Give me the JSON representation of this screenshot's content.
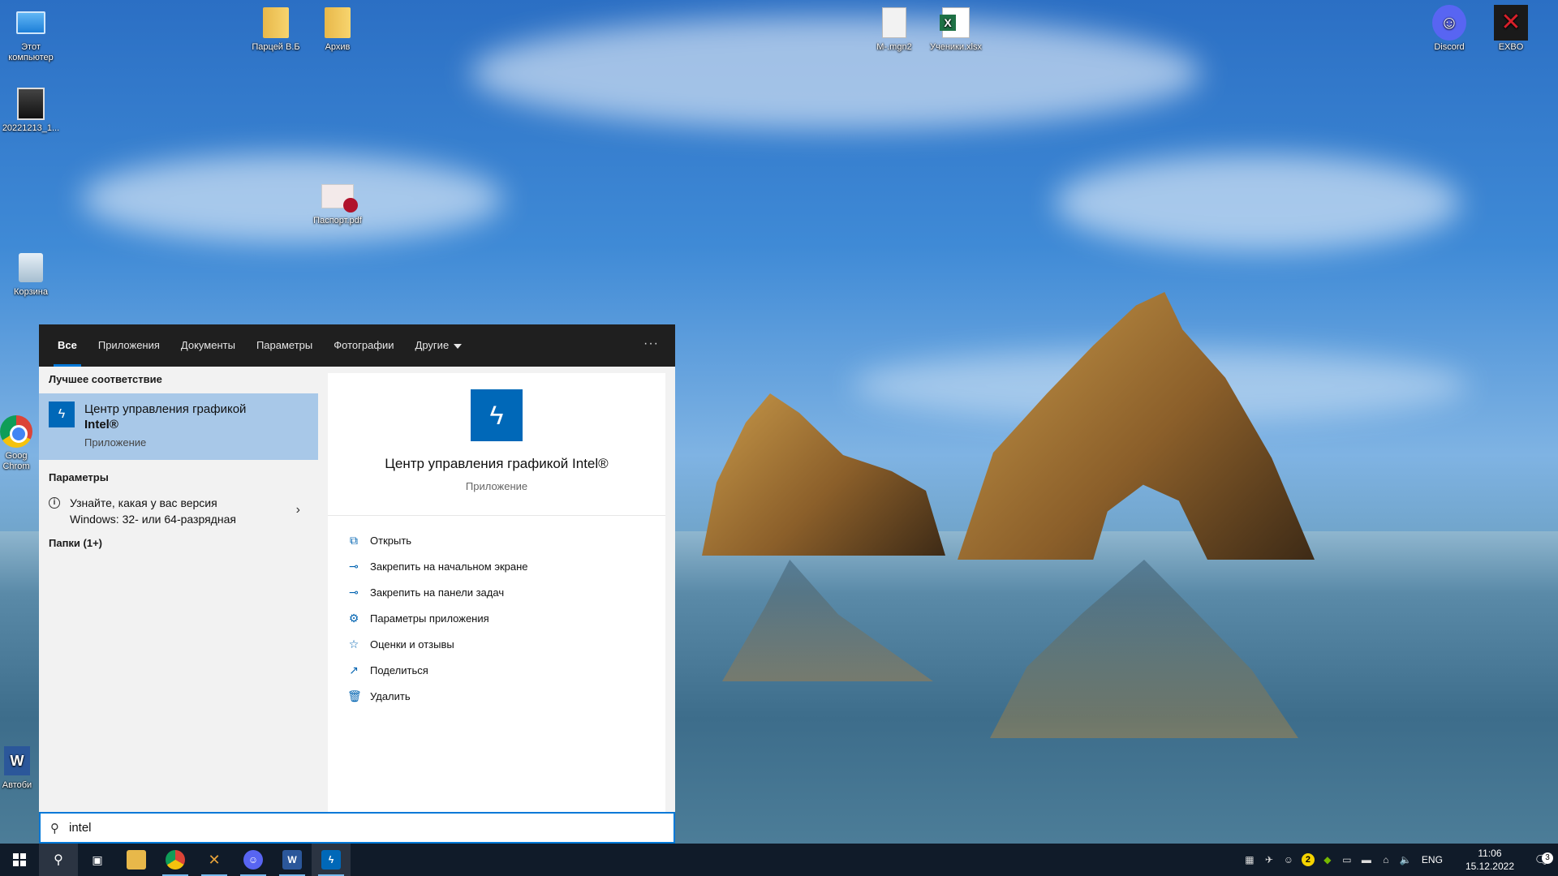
{
  "desktop": {
    "icons": [
      {
        "label": "Этот компьютер"
      },
      {
        "label": "20221213_1..."
      },
      {
        "label": "Корзина"
      },
      {
        "label": "Goog Chrom"
      },
      {
        "label": "Автоби"
      },
      {
        "label": "Парцей В.Б"
      },
      {
        "label": "Архив"
      },
      {
        "label": "Паспорт.pdf"
      },
      {
        "label": "M-.mgn2"
      },
      {
        "label": "Ученики.xlsx"
      },
      {
        "label": "Discord"
      },
      {
        "label": "EXBO"
      }
    ]
  },
  "search": {
    "tabs": [
      {
        "label": "Все"
      },
      {
        "label": "Приложения"
      },
      {
        "label": "Документы"
      },
      {
        "label": "Параметры"
      },
      {
        "label": "Фотографии"
      },
      {
        "label": "Другие"
      }
    ],
    "more_label": "···",
    "best_match_header": "Лучшее соответствие",
    "best_match": {
      "title_line1": "Центр управления графикой",
      "title_line2": "Intel®",
      "subtitle": "Приложение"
    },
    "settings_header": "Параметры",
    "settings_item": {
      "line1": "Узнайте, какая у вас версия",
      "line2": "Windows: 32- или 64-разрядная"
    },
    "folders_header": "Папки (1+)",
    "detail": {
      "title": "Центр управления графикой Intel®",
      "subtitle": "Приложение"
    },
    "actions": [
      {
        "label": "Открыть",
        "icon": "open-icon"
      },
      {
        "label": "Закрепить на начальном экране",
        "icon": "pin-icon"
      },
      {
        "label": "Закрепить на панели задач",
        "icon": "pin-icon"
      },
      {
        "label": "Параметры приложения",
        "icon": "gear-icon"
      },
      {
        "label": "Оценки и отзывы",
        "icon": "star-icon"
      },
      {
        "label": "Поделиться",
        "icon": "share-icon"
      },
      {
        "label": "Удалить",
        "icon": "trash-icon"
      }
    ],
    "query": "intel"
  },
  "taskbar": {
    "tray": {
      "badge_count": "2",
      "language": "ENG",
      "time": "11:06",
      "date": "15.12.2022",
      "notifications": "3"
    }
  },
  "colors": {
    "accent": "#0078d7",
    "taskbar": "#101b29",
    "best_match_bg": "#a8c8e8",
    "intel_blue": "#0068b8"
  }
}
